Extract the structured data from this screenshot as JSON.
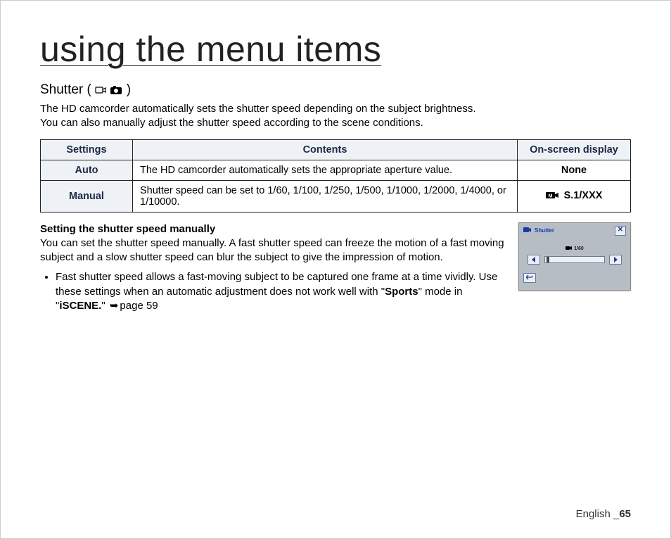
{
  "title": "using the menu items",
  "section": {
    "heading_prefix": "Shutter (",
    "heading_suffix": " )",
    "desc_line1": "The HD camcorder automatically sets the shutter speed depending on the subject brightness.",
    "desc_line2": "You can also manually adjust the shutter speed according to the scene conditions."
  },
  "table": {
    "headers": {
      "settings": "Settings",
      "contents": "Contents",
      "display": "On-screen display"
    },
    "rows": [
      {
        "setting": "Auto",
        "contents": "The HD camcorder automatically sets the appropriate aperture value.",
        "display": "None",
        "display_icon": false
      },
      {
        "setting": "Manual",
        "contents": "Shutter speed can be set to 1/60, 1/100, 1/250, 1/500, 1/1000, 1/2000, 1/4000, or 1/10000.",
        "display": "S.1/XXX",
        "display_icon": true
      }
    ]
  },
  "manual": {
    "heading": "Setting the shutter speed manually",
    "para": "You can set the shutter speed manually. A fast shutter speed can freeze the motion of a fast moving subject and a slow shutter speed can blur the subject to give the impression of motion.",
    "bullet_pre": "Fast shutter speed allows a fast-moving subject to be captured one frame at a time vividly. Use these settings when an automatic adjustment does not work well with \"",
    "bullet_sports": "Sports",
    "bullet_mid": "\" mode in \"",
    "bullet_iscene": "iSCENE.",
    "bullet_post": "\" ",
    "page_ref": "page 59"
  },
  "screen": {
    "title": "Shutter",
    "value": "1/60"
  },
  "footer": {
    "lang": "English ",
    "sep": "_",
    "page": "65"
  }
}
